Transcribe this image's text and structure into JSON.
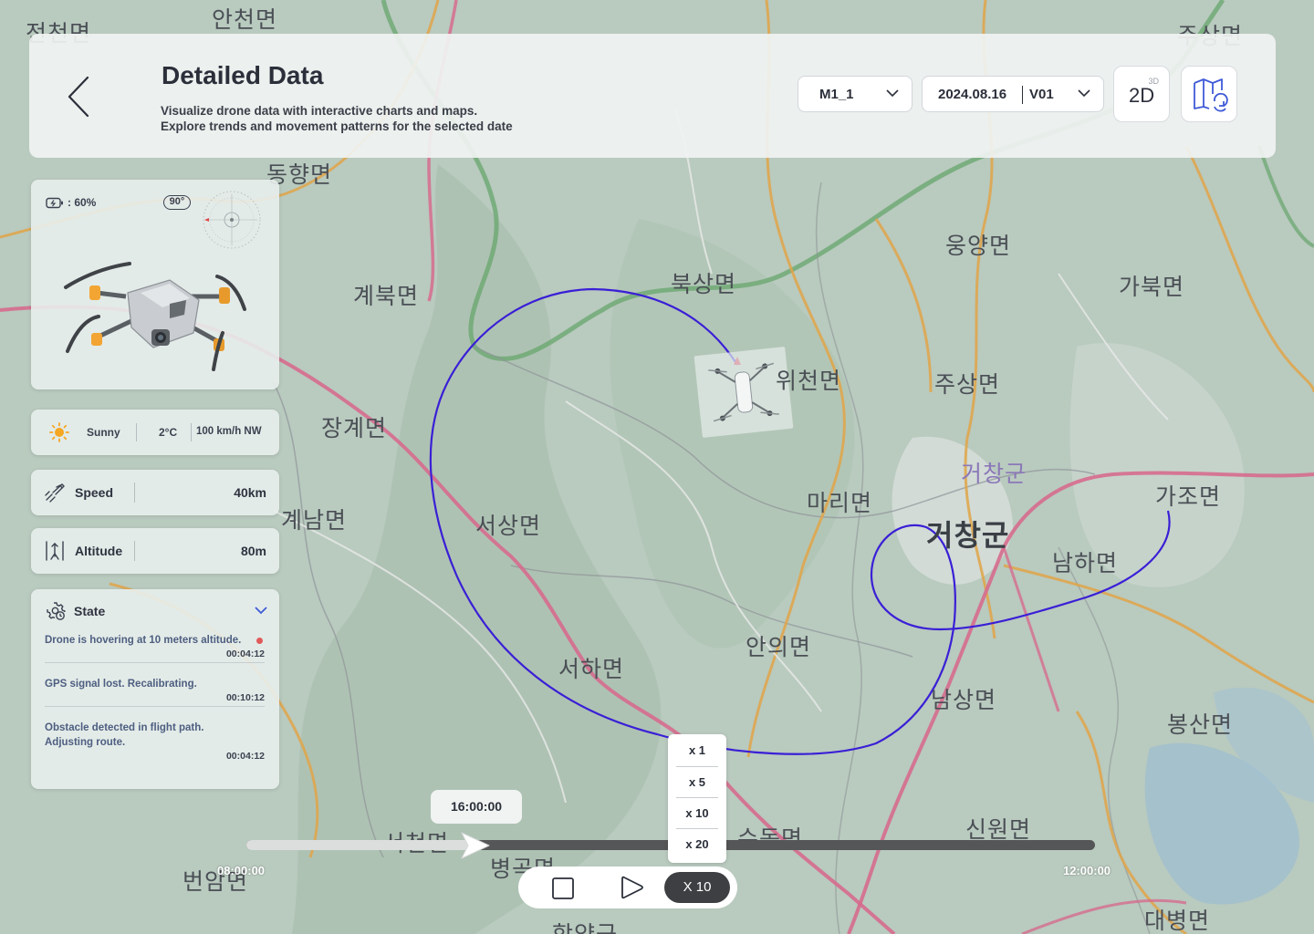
{
  "header": {
    "title": "Detailed Data",
    "subtitle": "Visualize drone data with interactive charts and maps.\nExplore trends and movement patterns for the selected date",
    "mission_select": "M1_1",
    "date": "2024.08.16",
    "version": "V01",
    "view_mode": "2D",
    "view_mode_alt": "3D"
  },
  "map": {
    "places": [
      "안천면",
      "전천면",
      "주상면",
      "동향면",
      "계북면",
      "장계면",
      "계남면",
      "북상면",
      "위천면",
      "웅양면",
      "가북면",
      "주상면",
      "거창군",
      "거창군",
      "가조면",
      "마리면",
      "서상면",
      "남하면",
      "서하면",
      "안의면",
      "남상면",
      "봉산면",
      "신원면",
      "번암면",
      "병곡면",
      "대병면",
      "서천면",
      "수동면",
      "함양군"
    ]
  },
  "drone": {
    "battery": ": 60%",
    "heading": "90°"
  },
  "weather": {
    "condition": "Sunny",
    "temperature": "2°C",
    "wind": "100 km/h NW"
  },
  "metrics": {
    "speed_label": "Speed",
    "speed_value": "40km",
    "altitude_label": "Altitude",
    "altitude_value": "80m"
  },
  "state": {
    "title": "State",
    "logs": [
      {
        "message": "Drone is hovering at 10 meters altitude.",
        "time": "00:04:12"
      },
      {
        "message": "GPS signal lost. Recalibrating.",
        "time": "00:10:12"
      },
      {
        "message": "Obstacle detected in flight path.\nAdjusting route.",
        "time": "00:04:12"
      }
    ]
  },
  "timeline": {
    "current_time": "16:00:00",
    "start_time": "08:00:00",
    "end_time": "12:00:00",
    "progress": 0.27
  },
  "playback": {
    "speed_options": [
      "x 1",
      "x 5",
      "x 10",
      "x 20"
    ],
    "current_rate": "X 10"
  },
  "colors": {
    "flight_path": "#3a1fd6",
    "playback_rate_bg": "#3d3f42"
  }
}
